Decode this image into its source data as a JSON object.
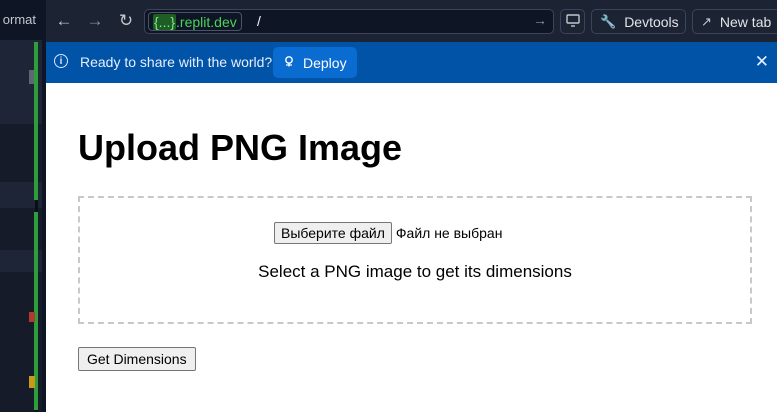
{
  "side_panel": {
    "label": "ormat"
  },
  "toolbar": {
    "url": {
      "host_brace": "{...}",
      "host": ".replit.dev",
      "path": "/"
    },
    "devtools_label": "Devtools",
    "new_tab_label": "New tab"
  },
  "banner": {
    "message": "Ready to share with the world?",
    "deploy_label": "Deploy"
  },
  "page": {
    "title": "Upload PNG Image",
    "file_button_label": "Выберите файл",
    "file_status": "Файл не выбран",
    "hint": "Select a PNG image to get its dimensions",
    "get_dimensions_label": "Get Dimensions"
  },
  "icons": {
    "back": "arrow-left-icon",
    "forward": "arrow-right-icon",
    "reload": "reload-icon",
    "go": "arrow-right-icon",
    "screen": "monitor-icon",
    "devtools": "wrench-icon",
    "new_tab": "external-link-icon",
    "info": "info-icon",
    "deploy": "deploy-icon",
    "close": "close-icon"
  },
  "colors": {
    "banner_bg": "#0053a6",
    "deploy_button_bg": "#0a6bd1",
    "toolbar_bg": "#1c2333",
    "url_host": "#4bd35a"
  }
}
